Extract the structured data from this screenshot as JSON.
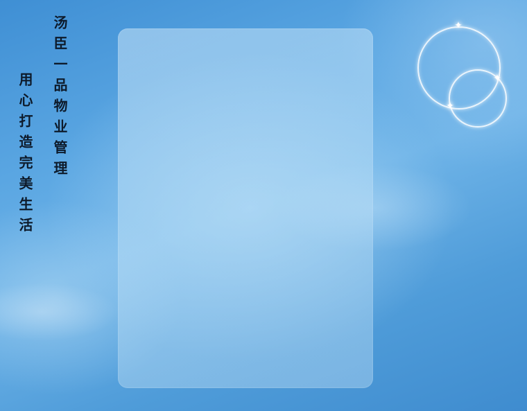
{
  "headline": {
    "line_1": "汤臣一品物业管理",
    "line_2": "用心打造完美生活"
  },
  "colors": {
    "background": "#4f9cd9",
    "panel": "#b7dcf4",
    "text": "#0d1a2a",
    "ring": "#ffffff"
  },
  "decor": {
    "sparkle_glyph": "✦"
  }
}
